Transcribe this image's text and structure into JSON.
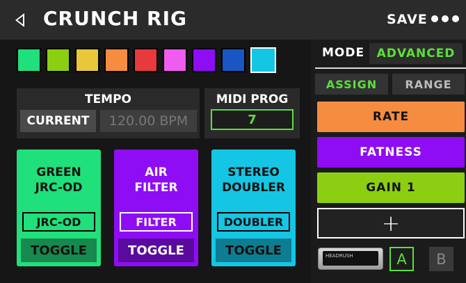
{
  "header": {
    "title": "CRUNCH RIG",
    "save_label": "SAVE"
  },
  "swatches": [
    {
      "color": "#1fe07a",
      "selected": false
    },
    {
      "color": "#8cce12",
      "selected": false
    },
    {
      "color": "#e8c83a",
      "selected": false
    },
    {
      "color": "#f58c40",
      "selected": false
    },
    {
      "color": "#e8393c",
      "selected": false
    },
    {
      "color": "#f05cf0",
      "selected": false
    },
    {
      "color": "#8e0df5",
      "selected": false
    },
    {
      "color": "#1a55c4",
      "selected": false
    },
    {
      "color": "#14c6e4",
      "selected": true
    }
  ],
  "tempo": {
    "label": "TEMPO",
    "source": "CURRENT",
    "bpm": "120.00 BPM"
  },
  "midi": {
    "label": "MIDI PROG",
    "value": "7"
  },
  "cards": [
    {
      "name_line1": "GREEN",
      "name_line2": "JRC-OD",
      "button": "JRC-OD",
      "toggle": "TOGGLE",
      "color": "#1fe07a",
      "toggle_bg": "#17884e",
      "text_color": "#111"
    },
    {
      "name_line1": "AIR",
      "name_line2": "FILTER",
      "button": "FILTER",
      "toggle": "TOGGLE",
      "color": "#8e0df5",
      "toggle_bg": "#5a0a9c",
      "text_color": "#fff"
    },
    {
      "name_line1": "STEREO",
      "name_line2": "DOUBLER",
      "button": "DOUBLER",
      "toggle": "TOGGLE",
      "color": "#14c6e4",
      "toggle_bg": "#0e7d91",
      "text_color": "#111"
    }
  ],
  "right": {
    "mode_label": "MODE",
    "mode_value": "ADVANCED",
    "tab_assign": "ASSIGN",
    "tab_range": "RANGE",
    "controls": [
      {
        "label": "RATE",
        "color": "#f58c40",
        "text_color": "#111"
      },
      {
        "label": "FATNESS",
        "color": "#8e0df5",
        "text_color": "#fff"
      },
      {
        "label": "GAIN 1",
        "color": "#8cce12",
        "text_color": "#111"
      }
    ],
    "add_symbol": "+",
    "pedal_brand": "HEADRUSH",
    "footswitch_a": "A",
    "footswitch_b": "B"
  }
}
